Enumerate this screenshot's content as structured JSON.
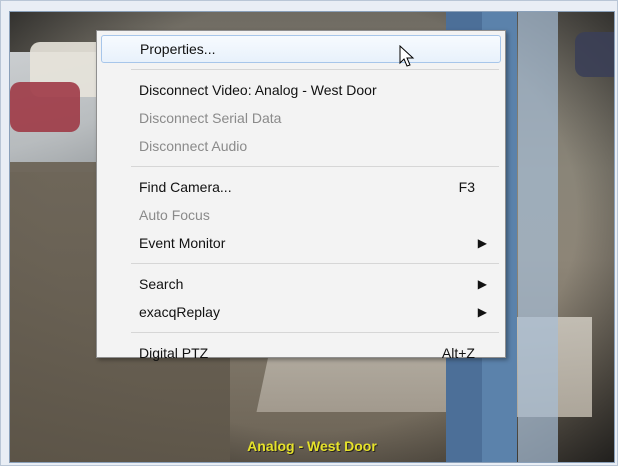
{
  "video": {
    "overlay_label": "Analog - West Door"
  },
  "context_menu": {
    "items": [
      {
        "label": "Properties...",
        "shortcut": "",
        "submenu": false,
        "disabled": false,
        "highlight": true
      },
      {
        "label": "Disconnect Video: Analog - West Door",
        "shortcut": "",
        "submenu": false,
        "disabled": false,
        "highlight": false
      },
      {
        "label": "Disconnect Serial Data",
        "shortcut": "",
        "submenu": false,
        "disabled": true,
        "highlight": false
      },
      {
        "label": "Disconnect Audio",
        "shortcut": "",
        "submenu": false,
        "disabled": true,
        "highlight": false
      },
      {
        "label": "Find Camera...",
        "shortcut": "F3",
        "submenu": false,
        "disabled": false,
        "highlight": false
      },
      {
        "label": "Auto Focus",
        "shortcut": "",
        "submenu": false,
        "disabled": true,
        "highlight": false
      },
      {
        "label": "Event Monitor",
        "shortcut": "",
        "submenu": true,
        "disabled": false,
        "highlight": false
      },
      {
        "label": "Search",
        "shortcut": "",
        "submenu": true,
        "disabled": false,
        "highlight": false
      },
      {
        "label": "exacqReplay",
        "shortcut": "",
        "submenu": true,
        "disabled": false,
        "highlight": false
      },
      {
        "label": "Digital PTZ",
        "shortcut": "Alt+Z",
        "submenu": false,
        "disabled": false,
        "highlight": false
      }
    ]
  },
  "icons": {
    "submenu_arrow": "chevron-right-icon",
    "cursor": "mouse-pointer-icon"
  },
  "colors": {
    "overlay_text": "#e6e22a",
    "menu_bg": "#f3f3f3",
    "highlight_border": "#a7c6ea"
  }
}
